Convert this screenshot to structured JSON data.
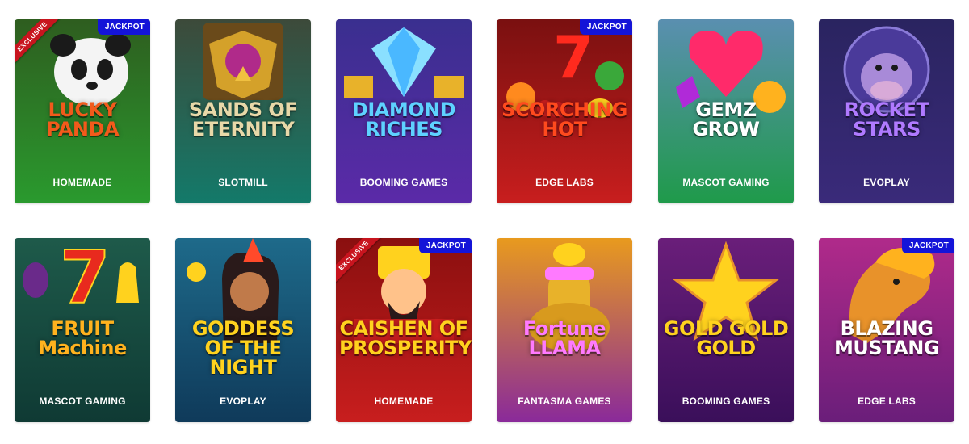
{
  "games": [
    {
      "title_line1": "LUCKY",
      "title_line2": "PANDA",
      "provider": "HOMEMADE",
      "jackpot": "JACKPOT",
      "exclusive": "EXCLUSIVE",
      "bg_top": "#2e5d1f",
      "bg_bottom": "#2a9a2e",
      "title_color": "#f25a1b",
      "icon": "panda-icon"
    },
    {
      "title_line1": "SANDS OF",
      "title_line2": "ETERNITY",
      "provider": "SLOTMILL",
      "jackpot": "",
      "exclusive": "",
      "bg_top": "#3d4a3a",
      "bg_bottom": "#137a6a",
      "title_color": "#e8d8a8",
      "icon": "golden-eagle-icon"
    },
    {
      "title_line1": "DIAMOND",
      "title_line2": "RICHES",
      "provider": "BOOMING GAMES",
      "jackpot": "",
      "exclusive": "",
      "bg_top": "#3a2f8f",
      "bg_bottom": "#5b2aa8",
      "title_color": "#5ed2ff",
      "icon": "diamond-icon"
    },
    {
      "title_line1": "SCORCHING",
      "title_line2": "HOT",
      "provider": "EDGE LABS",
      "jackpot": "JACKPOT",
      "exclusive": "",
      "bg_top": "#7a1010",
      "bg_bottom": "#c81e1e",
      "title_color": "#ff4a1e",
      "icon": "fruits-icon"
    },
    {
      "title_line1": "GEMZ",
      "title_line2": "GROW",
      "provider": "MASCOT GAMING",
      "jackpot": "",
      "exclusive": "",
      "bg_top": "#5a8fb0",
      "bg_bottom": "#1f9a4a",
      "title_color": "#ffffff",
      "icon": "heart-gem-icon"
    },
    {
      "title_line1": "ROCKET",
      "title_line2": "STARS",
      "provider": "EVOPLAY",
      "jackpot": "",
      "exclusive": "",
      "bg_top": "#2a2460",
      "bg_bottom": "#3a2a7a",
      "title_color": "#b07aff",
      "icon": "space-cow-icon"
    },
    {
      "title_line1": "FRUIT",
      "title_line2": "Machine",
      "provider": "MASCOT GAMING",
      "jackpot": "",
      "exclusive": "",
      "bg_top": "#1e5a4a",
      "bg_bottom": "#0f3a34",
      "title_color": "#ffb21e",
      "icon": "lucky-seven-icon"
    },
    {
      "title_line1": "GODDESS OF THE",
      "title_line2": "NIGHT",
      "provider": "EVOPLAY",
      "jackpot": "",
      "exclusive": "",
      "bg_top": "#1e6a8a",
      "bg_bottom": "#0f3a5a",
      "title_color": "#ffd21e",
      "icon": "goddess-icon"
    },
    {
      "title_line1": "CAISHEN OF",
      "title_line2": "PROSPERITY",
      "provider": "HOMEMADE",
      "jackpot": "JACKPOT",
      "exclusive": "EXCLUSIVE",
      "bg_top": "#8a0f0f",
      "bg_bottom": "#c81e1e",
      "title_color": "#ffd21e",
      "icon": "caishen-icon"
    },
    {
      "title_line1": "Fortune",
      "title_line2": "LLAMA",
      "provider": "FANTASMA GAMES",
      "jackpot": "",
      "exclusive": "",
      "bg_top": "#e89a1e",
      "bg_bottom": "#8a2a9a",
      "title_color": "#ff7aff",
      "icon": "llama-icon"
    },
    {
      "title_line1": "GOLD GOLD GOLD",
      "title_line2": "",
      "provider": "BOOMING GAMES",
      "jackpot": "",
      "exclusive": "",
      "bg_top": "#6a1e7a",
      "bg_bottom": "#3a0f5a",
      "title_color": "#ffd21e",
      "icon": "gold-star-icon"
    },
    {
      "title_line1": "BLAZING",
      "title_line2": "MUSTANG",
      "provider": "EDGE LABS",
      "jackpot": "JACKPOT",
      "exclusive": "",
      "bg_top": "#b02a8a",
      "bg_bottom": "#6a1e7a",
      "title_color": "#ffffff",
      "icon": "horse-icon"
    }
  ]
}
